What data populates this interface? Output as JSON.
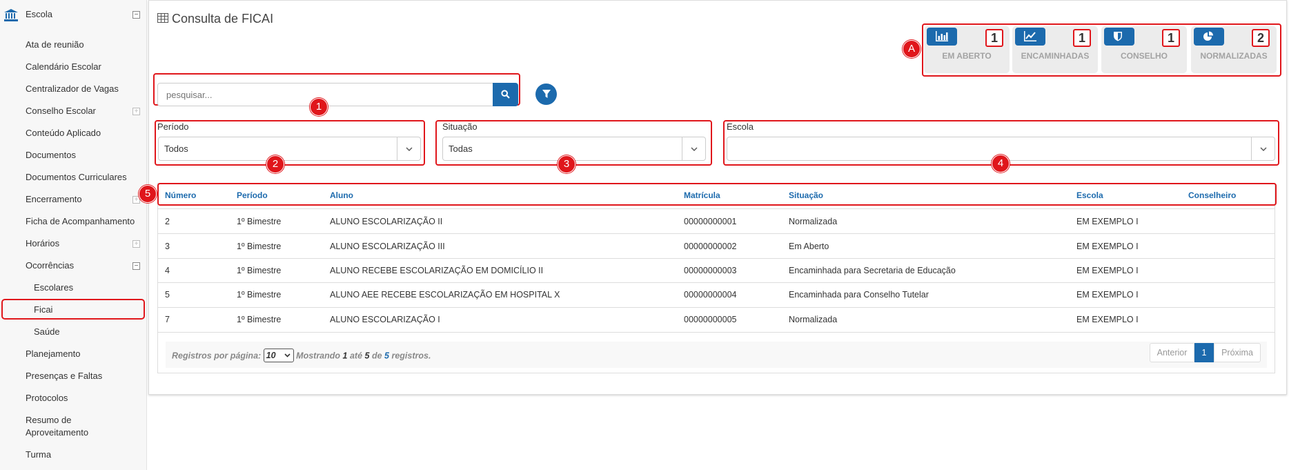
{
  "sidebar": {
    "section_title": "Escola",
    "items": [
      {
        "label": "Ata de reunião"
      },
      {
        "label": "Calendário Escolar"
      },
      {
        "label": "Centralizador de Vagas"
      },
      {
        "label": "Conselho Escolar"
      },
      {
        "label": "Conteúdo Aplicado"
      },
      {
        "label": "Documentos"
      },
      {
        "label": "Documentos Curriculares"
      },
      {
        "label": "Encerramento"
      },
      {
        "label": "Ficha de Acompanhamento"
      },
      {
        "label": "Horários"
      },
      {
        "label": "Ocorrências"
      },
      {
        "label": "Escolares"
      },
      {
        "label": "Ficai"
      },
      {
        "label": "Saúde"
      },
      {
        "label": "Planejamento"
      },
      {
        "label": "Presenças e Faltas"
      },
      {
        "label": "Protocolos"
      },
      {
        "label": "Resumo de"
      },
      {
        "label": "Aproveitamento"
      },
      {
        "label": "Turma"
      }
    ]
  },
  "page": {
    "title": "Consulta de FICAI"
  },
  "stats": [
    {
      "label": "EM ABERTO",
      "count": "1",
      "icon": "bar-chart-icon"
    },
    {
      "label": "ENCAMINHADAS",
      "count": "1",
      "icon": "line-chart-icon"
    },
    {
      "label": "CONSELHO",
      "count": "1",
      "icon": "shield-icon"
    },
    {
      "label": "NORMALIZADAS",
      "count": "2",
      "icon": "pie-chart-icon"
    }
  ],
  "callouts": {
    "a": "A",
    "one": "1",
    "two": "2",
    "three": "3",
    "four": "4",
    "five": "5"
  },
  "search": {
    "placeholder": "pesquisar..."
  },
  "filters": {
    "periodo": {
      "label": "Período",
      "value": "Todos"
    },
    "situacao": {
      "label": "Situação",
      "value": "Todas"
    },
    "escola": {
      "label": "Escola",
      "value": ""
    }
  },
  "table": {
    "headers": [
      "Número",
      "Período",
      "Aluno",
      "Matrícula",
      "Situação",
      "Escola",
      "Conselheiro"
    ],
    "rows": [
      [
        "2",
        "1º Bimestre",
        "ALUNO ESCOLARIZAÇÃO II",
        "00000000001",
        "Normalizada",
        "EM EXEMPLO I",
        ""
      ],
      [
        "3",
        "1º Bimestre",
        "ALUNO ESCOLARIZAÇÃO III",
        "00000000002",
        "Em Aberto",
        "EM EXEMPLO I",
        ""
      ],
      [
        "4",
        "1º Bimestre",
        "ALUNO RECEBE ESCOLARIZAÇÃO EM DOMICÍLIO II",
        "00000000003",
        "Encaminhada para Secretaria de Educação",
        "EM EXEMPLO I",
        ""
      ],
      [
        "5",
        "1º Bimestre",
        "ALUNO AEE RECEBE ESCOLARIZAÇÃO EM HOSPITAL X",
        "00000000004",
        "Encaminhada para Conselho Tutelar",
        "EM EXEMPLO I",
        ""
      ],
      [
        "7",
        "1º Bimestre",
        "ALUNO ESCOLARIZAÇÃO I",
        "00000000005",
        "Normalizada",
        "EM EXEMPLO I",
        ""
      ]
    ]
  },
  "footer": {
    "per_page_label": "Registros por página:",
    "per_page_value": "10",
    "showing_prefix": "Mostrando",
    "from": "1",
    "to_word": "até",
    "to": "5",
    "of_word": "de",
    "total": "5",
    "suffix": "registros."
  },
  "pagination": {
    "prev": "Anterior",
    "current": "1",
    "next": "Próxima"
  },
  "colors": {
    "primary": "#1c6aad",
    "highlight": "#e0161b"
  }
}
